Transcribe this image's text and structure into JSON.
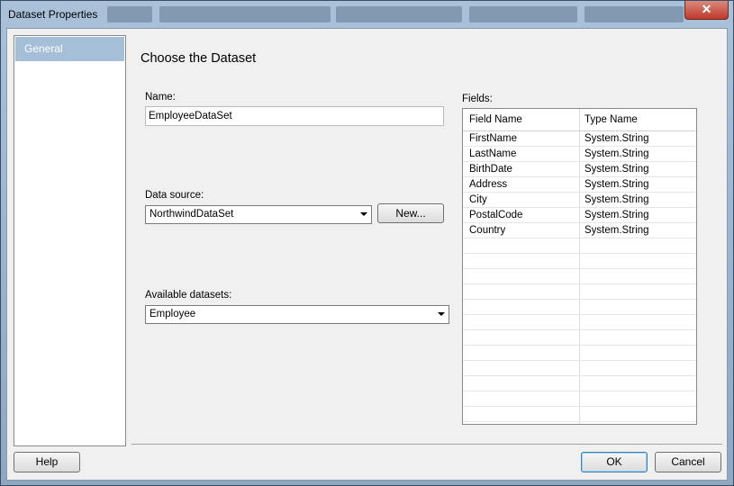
{
  "window": {
    "title": "Dataset Properties",
    "close_glyph": "✕"
  },
  "nav": {
    "items": [
      {
        "label": "General",
        "selected": true
      }
    ]
  },
  "main": {
    "heading": "Choose the Dataset",
    "name_label": "Name:",
    "name_value": "EmployeeDataSet",
    "datasource_label": "Data source:",
    "datasource_value": "NorthwindDataSet",
    "new_button_label": "New...",
    "available_label": "Available datasets:",
    "available_value": "Employee",
    "fields_label": "Fields:"
  },
  "fields": {
    "columns": [
      "Field Name",
      "Type Name"
    ],
    "rows": [
      [
        "FirstName",
        "System.String"
      ],
      [
        "LastName",
        "System.String"
      ],
      [
        "BirthDate",
        "System.String"
      ],
      [
        "Address",
        "System.String"
      ],
      [
        "City",
        "System.String"
      ],
      [
        "PostalCode",
        "System.String"
      ],
      [
        "Country",
        "System.String"
      ]
    ]
  },
  "footer": {
    "help_label": "Help",
    "ok_label": "OK",
    "cancel_label": "Cancel"
  },
  "colors": {
    "selection": "#a4bfd7",
    "frame": "#a9c1d9",
    "close": "#c0392b"
  }
}
